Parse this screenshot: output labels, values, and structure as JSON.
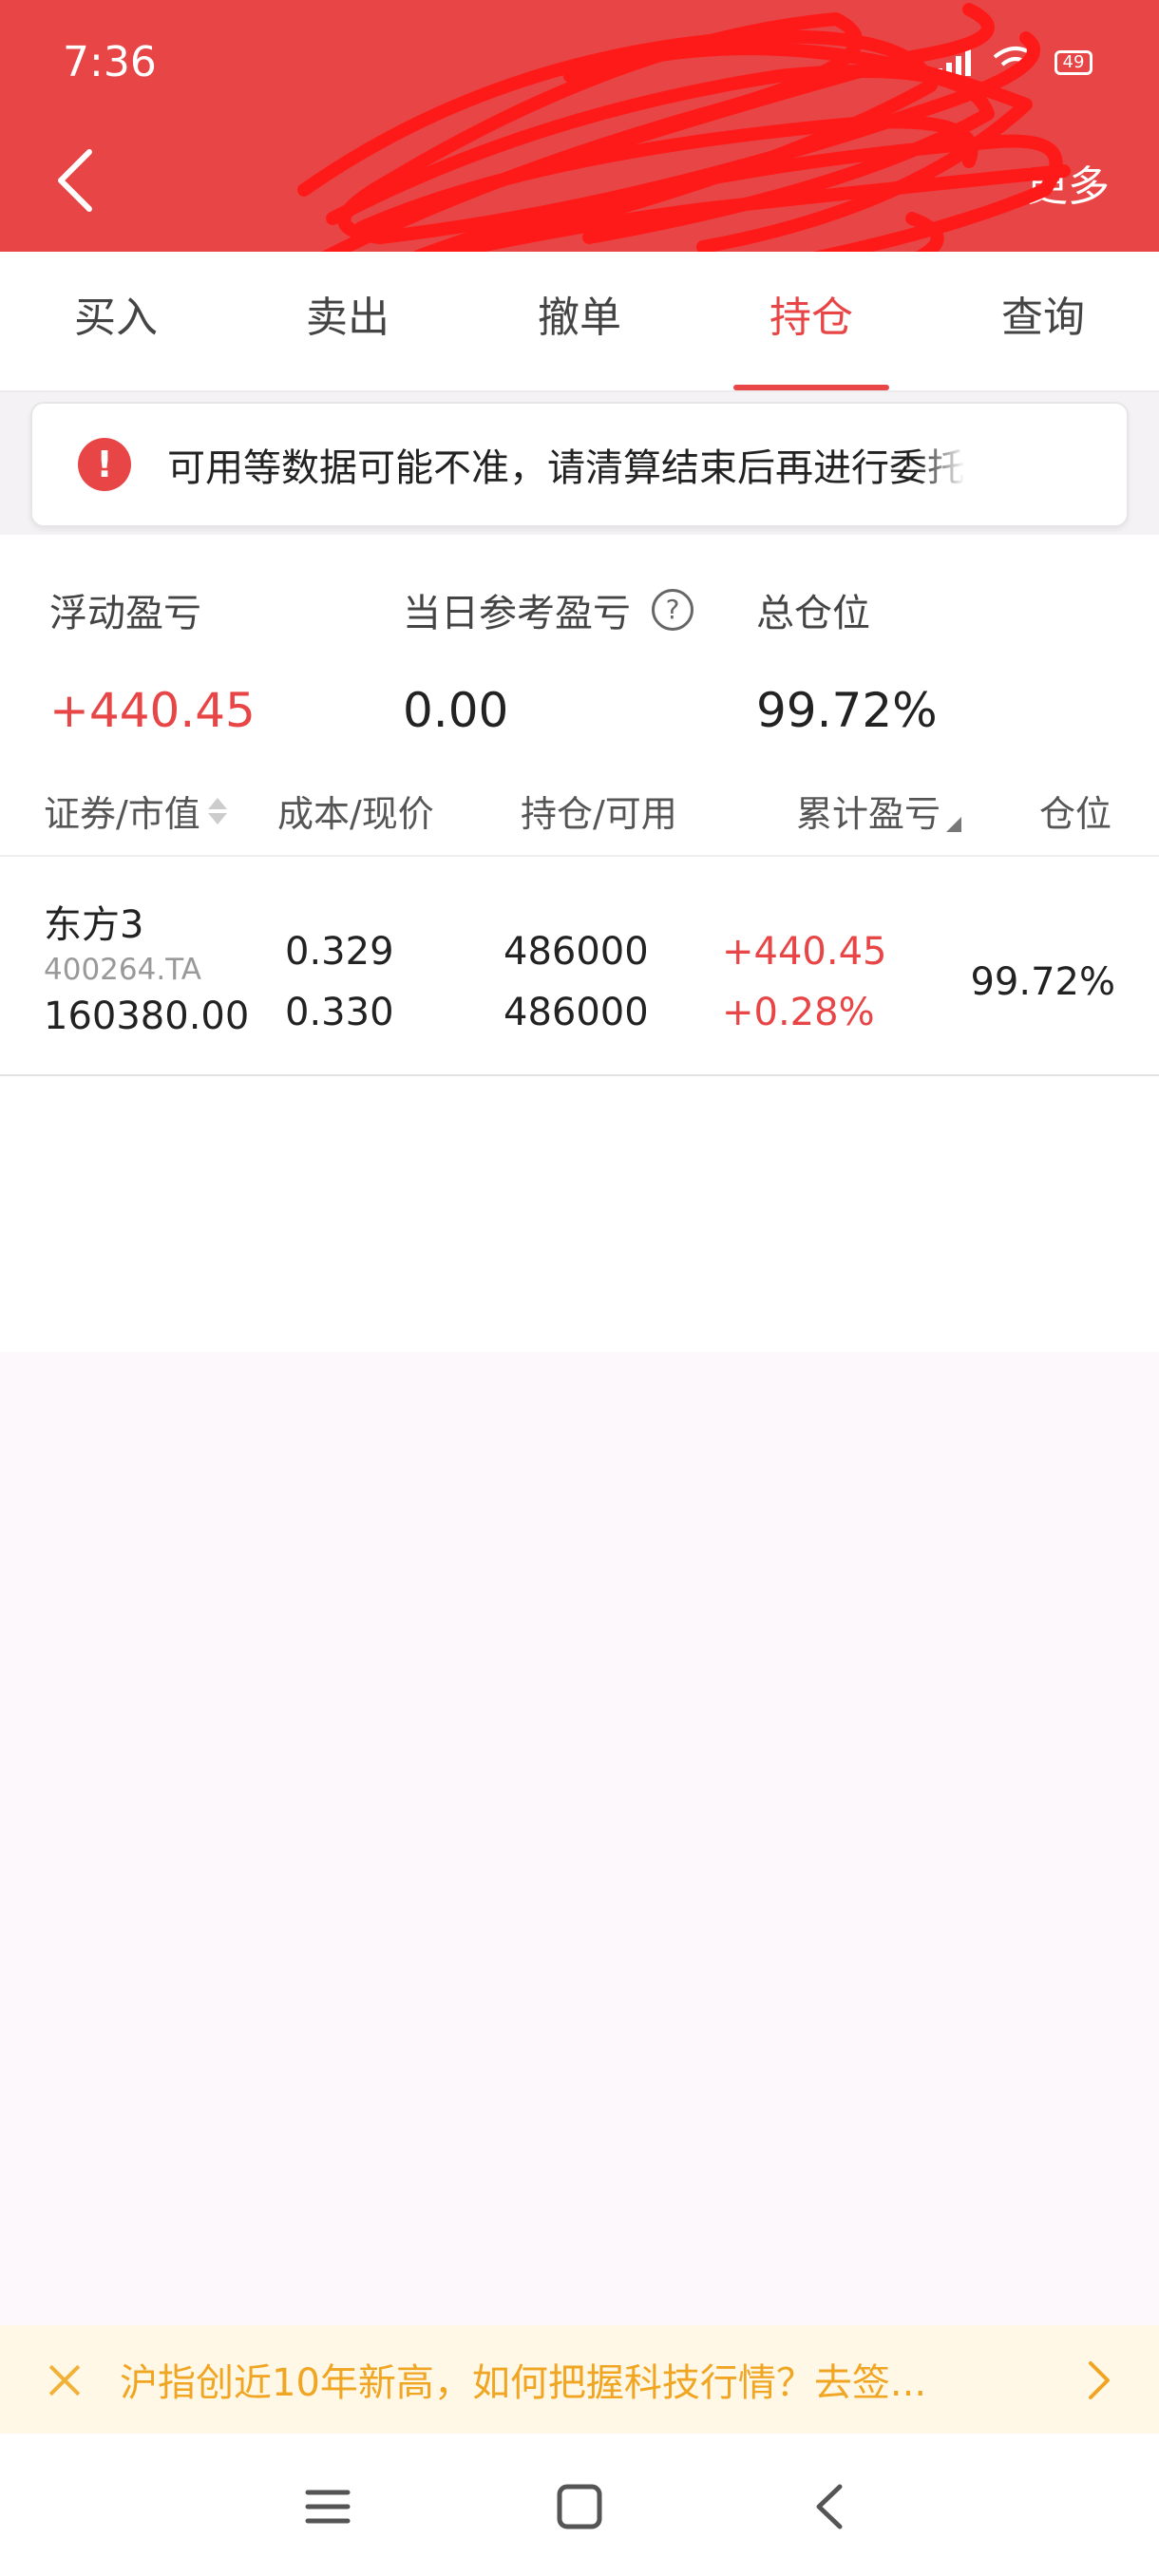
{
  "status_bar": {
    "time": "7:36",
    "battery": "49"
  },
  "header": {
    "more_label": "更多"
  },
  "tabs": [
    {
      "label": "买入"
    },
    {
      "label": "卖出"
    },
    {
      "label": "撤单"
    },
    {
      "label": "持仓",
      "active": true
    },
    {
      "label": "查询"
    }
  ],
  "notice": {
    "icon_text": "!",
    "text": "可用等数据可能不准，请清算结束后再进行委托"
  },
  "summary": {
    "floating_pl_label": "浮动盈亏",
    "floating_pl_value": "+440.45",
    "daily_ref_pl_label": "当日参考盈亏",
    "daily_ref_pl_value": "0.00",
    "help_icon_text": "?",
    "total_position_label": "总仓位",
    "total_position_value": "99.72%"
  },
  "table": {
    "headers": {
      "security": "证券/市值",
      "cost_price": "成本/现价",
      "holding_available": "持仓/可用",
      "cumulative_pl": "累计盈亏",
      "position": "仓位"
    },
    "rows": [
      {
        "name": "东方3",
        "code": "400264.TA",
        "market_value": "160380.00",
        "cost": "0.329",
        "price": "0.330",
        "holding": "486000",
        "available": "486000",
        "pl_amount": "+440.45",
        "pl_percent": "+0.28%",
        "position": "99.72%"
      }
    ]
  },
  "promo": {
    "text": "沪指创近10年新高，如何把握科技行情？去签..."
  },
  "colors": {
    "brand_red": "#e84546",
    "promo_orange": "#f0a523",
    "promo_bg": "#fff8e6"
  },
  "icons": {
    "back": "chevron-left-icon",
    "alert": "exclamation-circle-icon",
    "help": "question-circle-icon",
    "close": "close-icon",
    "forward": "chevron-right-icon",
    "nav_menu": "menu-icon",
    "nav_home": "square-home-icon",
    "nav_back": "triangle-back-icon"
  }
}
